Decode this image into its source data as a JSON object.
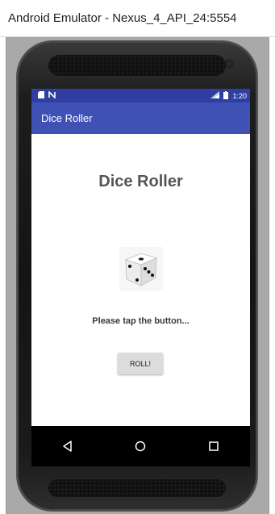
{
  "window": {
    "title": "Android Emulator - Nexus_4_API_24:5554"
  },
  "status_bar": {
    "time": "1:20",
    "left_icons": [
      "sd-card-icon",
      "notification-n-icon"
    ],
    "right_icons": [
      "signal-icon",
      "battery-icon"
    ]
  },
  "app_bar": {
    "title": "Dice Roller"
  },
  "main": {
    "heading": "Dice Roller",
    "dice_icon": "dice-icon",
    "message": "Please tap the button...",
    "roll_button_label": "ROLL!"
  },
  "nav_bar": {
    "items": [
      "back-icon",
      "home-icon",
      "recents-icon"
    ]
  },
  "colors": {
    "app_bar": "#3f51b5",
    "status_bar": "#303f9f",
    "nav_bar": "#000000",
    "button": "#dcdcdc",
    "heading_text": "#555555"
  }
}
